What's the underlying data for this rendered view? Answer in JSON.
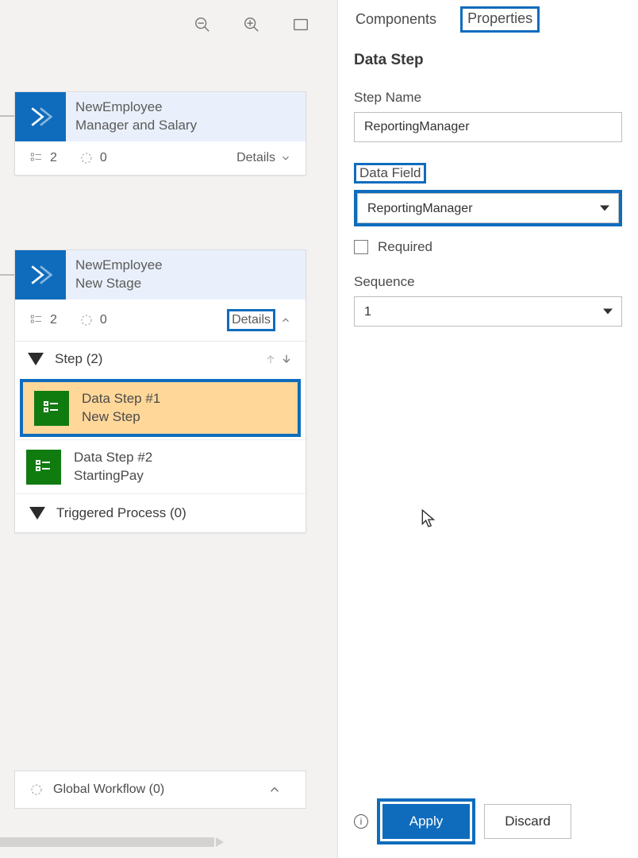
{
  "toolbar": {
    "zoom_out": "zoom-out",
    "zoom_in": "zoom-in",
    "fit": "fit-to-screen"
  },
  "stages": [
    {
      "entity": "NewEmployee",
      "name": "Manager and Salary",
      "step_count": "2",
      "trigger_count": "0",
      "details_label": "Details",
      "expanded": false
    },
    {
      "entity": "NewEmployee",
      "name": "New Stage",
      "step_count": "2",
      "trigger_count": "0",
      "details_label": "Details",
      "expanded": true,
      "steps_header": "Step (2)",
      "steps": [
        {
          "title": "Data Step #1",
          "subtitle": "New Step",
          "selected": true
        },
        {
          "title": "Data Step #2",
          "subtitle": "StartingPay",
          "selected": false
        }
      ],
      "triggered_header": "Triggered Process (0)"
    }
  ],
  "global_workflow": {
    "label": "Global Workflow (0)"
  },
  "panel": {
    "tabs": {
      "components": "Components",
      "properties": "Properties",
      "active": "properties"
    },
    "section_title": "Data Step",
    "step_name_label": "Step Name",
    "step_name_value": "ReportingManager",
    "data_field_label": "Data Field",
    "data_field_value": "ReportingManager",
    "required_label": "Required",
    "required_checked": false,
    "sequence_label": "Sequence",
    "sequence_value": "1",
    "footer": {
      "apply": "Apply",
      "discard": "Discard"
    }
  }
}
